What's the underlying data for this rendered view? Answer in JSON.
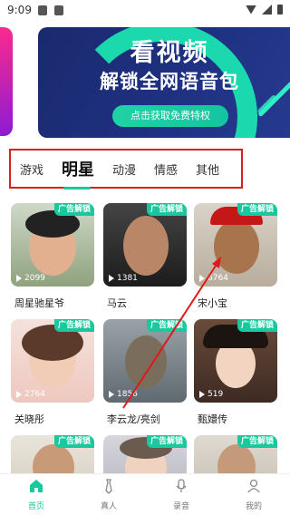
{
  "status_bar": {
    "time": "9:09"
  },
  "banner": {
    "title": "看视频",
    "subtitle": "解锁全网语音包",
    "cta": "点击获取免费特权"
  },
  "categories": {
    "tabs": [
      "游戏",
      "明星",
      "动漫",
      "情感",
      "其他"
    ],
    "active": "明星"
  },
  "grid": {
    "badge_label": "广告解锁",
    "items": [
      {
        "name": "周星驰星爷",
        "count": "2099"
      },
      {
        "name": "马云",
        "count": "1381"
      },
      {
        "name": "宋小宝",
        "count": "6764"
      },
      {
        "name": "关晓彤",
        "count": "2764"
      },
      {
        "name": "李云龙/亮剑",
        "count": "1856"
      },
      {
        "name": "甄嬛传",
        "count": "519"
      },
      {
        "name": "",
        "count": ""
      },
      {
        "name": "",
        "count": ""
      },
      {
        "name": "",
        "count": ""
      }
    ]
  },
  "bottom_nav": [
    {
      "label": "首页",
      "icon": "home-icon",
      "active": true
    },
    {
      "label": "真人",
      "icon": "tie-icon",
      "active": false
    },
    {
      "label": "录音",
      "icon": "mic-icon",
      "active": false
    },
    {
      "label": "我的",
      "icon": "user-icon",
      "active": false
    }
  ],
  "colors": {
    "accent": "#19c89c",
    "highlight_box": "#d61f1f",
    "banner_bg": "#1e2f7f"
  }
}
